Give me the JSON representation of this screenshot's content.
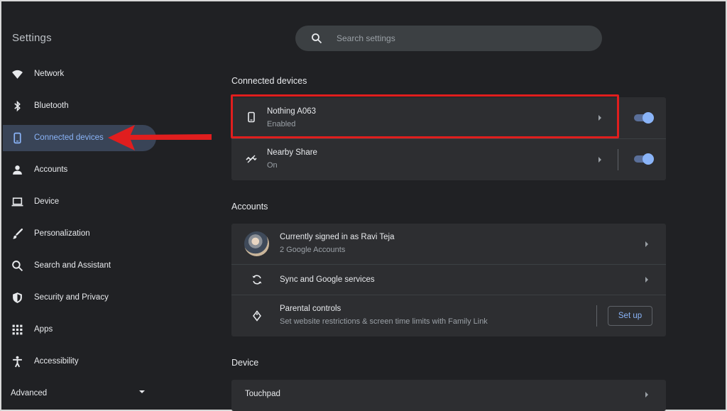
{
  "header": {
    "title": "Settings",
    "search": {
      "placeholder": "Search settings",
      "icon": "search-icon"
    }
  },
  "sidebar": {
    "items": [
      {
        "label": "Network",
        "icon": "wifi-icon"
      },
      {
        "label": "Bluetooth",
        "icon": "bluetooth-icon"
      },
      {
        "label": "Connected devices",
        "icon": "phone-icon",
        "active": true
      },
      {
        "label": "Accounts",
        "icon": "person-icon"
      },
      {
        "label": "Device",
        "icon": "laptop-icon"
      },
      {
        "label": "Personalization",
        "icon": "brush-icon"
      },
      {
        "label": "Search and Assistant",
        "icon": "search-icon"
      },
      {
        "label": "Security and Privacy",
        "icon": "shield-icon"
      },
      {
        "label": "Apps",
        "icon": "grid-icon"
      },
      {
        "label": "Accessibility",
        "icon": "accessibility-icon"
      }
    ],
    "advanced": {
      "label": "Advanced",
      "icon": "caret-down-icon"
    }
  },
  "main": {
    "connected_devices": {
      "title": "Connected devices",
      "rows": [
        {
          "title": "Nothing A063",
          "subtitle": "Enabled",
          "icon": "phone-icon",
          "toggle_on": true
        },
        {
          "title": "Nearby Share",
          "subtitle": "On",
          "icon": "nearby-share-icon",
          "toggle_on": true
        }
      ]
    },
    "accounts": {
      "title": "Accounts",
      "rows": [
        {
          "title": "Currently signed in as Ravi Teja",
          "subtitle": "2 Google Accounts",
          "icon": "avatar"
        },
        {
          "title": "Sync and Google services",
          "icon": "sync-icon"
        },
        {
          "title": "Parental controls",
          "subtitle": "Set website restrictions & screen time limits with Family Link",
          "icon": "parental-controls-icon",
          "button": "Set up"
        }
      ]
    },
    "device": {
      "title": "Device",
      "rows": [
        {
          "title": "Touchpad"
        }
      ]
    }
  },
  "colors": {
    "background": "#202124",
    "card": "#2d2e31",
    "accent": "#8ab4f8",
    "active_nav": "#394457",
    "highlight": "#e01e1e"
  }
}
